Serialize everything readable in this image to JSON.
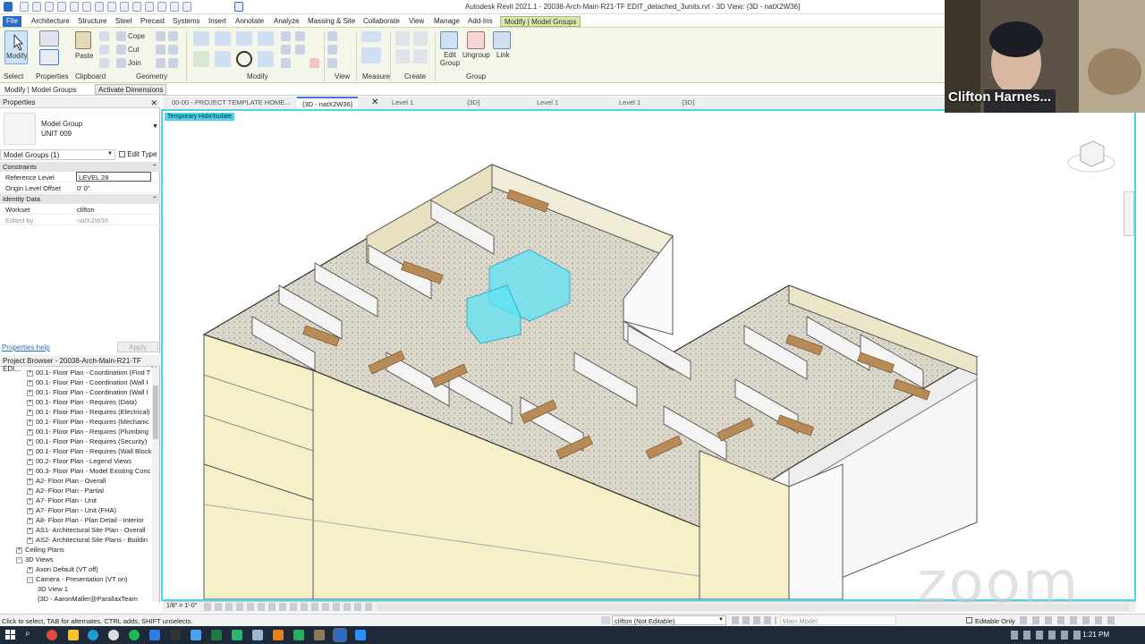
{
  "window": {
    "title": "Autodesk Revit 2021.1 - 20038-Arch-Main-R21-TF EDIT_detached_3units.rvt - 3D View: {3D - natX2W36}"
  },
  "ribbon_tabs": [
    "File",
    "Architecture",
    "Structure",
    "Steel",
    "Precast",
    "Systems",
    "Insert",
    "Annotate",
    "Analyze",
    "Massing & Site",
    "Collaborate",
    "View",
    "Manage",
    "Add-Ins",
    "Modify | Model Groups"
  ],
  "ribbon": {
    "modify_label": "Modify",
    "paste_label": "Paste",
    "cope_label": "Cope",
    "cut_label": "Cut",
    "join_label": "Join",
    "edit_group_label": "Edit Group",
    "ungroup_label": "Ungroup",
    "link_label": "Link",
    "panels": [
      "Select",
      "Properties",
      "Clipboard",
      "Geometry",
      "Modify",
      "View",
      "Measure",
      "Create",
      "Group"
    ]
  },
  "options_bar": {
    "context": "Modify | Model Groups",
    "activate_dimensions": "Activate Dimensions"
  },
  "view_tabs": [
    {
      "label": "00-00 - PROJECT TEMPLATE HOME...",
      "active": false
    },
    {
      "label": "{3D - natX2W36}",
      "active": true
    },
    {
      "label": "Level 1",
      "active": false
    },
    {
      "label": "{3D}",
      "active": false
    },
    {
      "label": "Level 1",
      "active": false
    },
    {
      "label": "Level 1",
      "active": false
    },
    {
      "label": "{3D}",
      "active": false
    }
  ],
  "properties": {
    "header": "Properties",
    "type_family": "Model Group",
    "type_name": "UNIT 009",
    "selector": "Model Groups (1)",
    "edit_type": "Edit Type",
    "cat_constraints": "Constraints",
    "reference_level_key": "Reference Level",
    "reference_level_val": "LEVEL 28",
    "origin_offset_key": "Origin Level Offset",
    "origin_offset_val": "0'  0\"",
    "cat_identity": "Identity Data",
    "workset_key": "Workset",
    "workset_val": "clifton",
    "edited_by_key": "Edited by",
    "edited_by_val": "natX2W36",
    "help": "Properties help",
    "apply": "Apply"
  },
  "browser": {
    "header": "Project Browser - 20038-Arch-Main-R21-TF EDI...",
    "items": [
      {
        "label": "00.1- Floor Plan - Coordination (Find T",
        "indent": 1,
        "box": "+"
      },
      {
        "label": "00.1- Floor Plan - Coordination (Wall I",
        "indent": 1,
        "box": "+"
      },
      {
        "label": "00.1- Floor Plan - Coordination (Wall I",
        "indent": 1,
        "box": "+"
      },
      {
        "label": "00.1- Floor Plan - Requires (Data)",
        "indent": 1,
        "box": "+"
      },
      {
        "label": "00.1- Floor Plan - Requires (Electrical)",
        "indent": 1,
        "box": "+"
      },
      {
        "label": "00.1- Floor Plan - Requires (Mechanic",
        "indent": 1,
        "box": "+"
      },
      {
        "label": "00.1- Floor Plan - Requires (Plumbing",
        "indent": 1,
        "box": "+"
      },
      {
        "label": "00.1- Floor Plan - Requires (Security)",
        "indent": 1,
        "box": "+"
      },
      {
        "label": "00.1- Floor Plan - Requires (Wall Block",
        "indent": 1,
        "box": "+"
      },
      {
        "label": "00.2- Floor Plan - Legend Views",
        "indent": 1,
        "box": "+"
      },
      {
        "label": "00.3- Floor Plan - Model Existing Conc",
        "indent": 1,
        "box": "+"
      },
      {
        "label": "A2- Floor Plan - Overall",
        "indent": 1,
        "box": "+"
      },
      {
        "label": "A2- Floor Plan - Partial",
        "indent": 1,
        "box": "+"
      },
      {
        "label": "A7- Floor Plan - Unit",
        "indent": 1,
        "box": "+"
      },
      {
        "label": "A7- Floor Plan - Unit (FHA)",
        "indent": 1,
        "box": "+"
      },
      {
        "label": "A8- Floor Plan - Plan Detail - Interior",
        "indent": 1,
        "box": "+"
      },
      {
        "label": "AS1- Architectural Site Plan - Overall",
        "indent": 1,
        "box": "+"
      },
      {
        "label": "AS2- Architectural Site Plans - Buildin",
        "indent": 1,
        "box": "+"
      },
      {
        "label": "Ceiling Plans",
        "indent": 0,
        "box": "+"
      },
      {
        "label": "3D Views",
        "indent": 0,
        "box": "-"
      },
      {
        "label": "Axon Default (VT off)",
        "indent": 1,
        "box": "+"
      },
      {
        "label": "Camera - Presentation (VT on)",
        "indent": 1,
        "box": "-"
      },
      {
        "label": "3D View 1",
        "indent": 2,
        "box": ""
      },
      {
        "label": "{3D - AaronMaller@ParallaxTeam",
        "indent": 2,
        "box": ""
      }
    ]
  },
  "viewport": {
    "temporary_tag": "Temporary Hide/Isolate"
  },
  "view_control": {
    "scale": "1/8\" = 1'-0\""
  },
  "status": {
    "hint": "Click to select, TAB for alternates, CTRL adds, SHIFT unselects.",
    "workset": "clifton (Not Editable)",
    "design_option": "Main Model",
    "editable_only": "Editable Only"
  },
  "webcam": {
    "name": "Clifton Harnes..."
  },
  "taskbar": {
    "time": "1:21 PM"
  },
  "zoom_watermark": "zoom"
}
